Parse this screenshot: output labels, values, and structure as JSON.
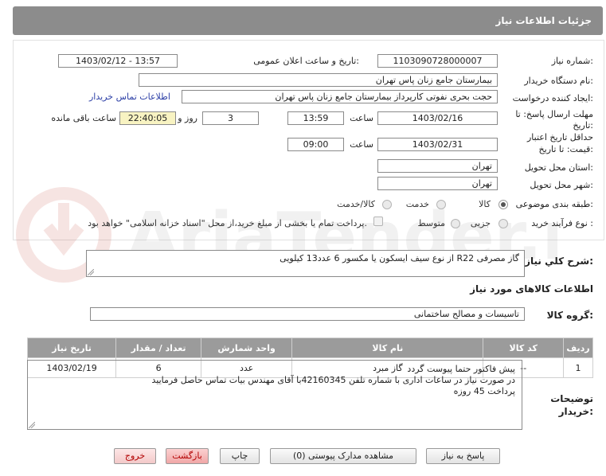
{
  "header": {
    "title": "جزئیات اطلاعات نیاز"
  },
  "form": {
    "need_number_label": "شماره نیاز:",
    "need_number": "1103090728000007",
    "announce_label": "تاریخ و ساعت اعلان عمومی:",
    "announce_value": "1403/02/12 - 13:57",
    "buyer_org_label": "نام دستگاه خریدار:",
    "buyer_org": "بیمارستان جامع زنان پاس تهران",
    "creator_label": "ایجاد کننده درخواست:",
    "creator": "حجت بحری نفوتی کارپرداز بیمارستان جامع زنان پاس تهران",
    "contact_link": "اطلاعات تماس خریدار",
    "deadline_label_1": "مهلت ارسال پاسخ: تا",
    "deadline_label_2": "تاریخ:",
    "deadline_date": "1403/02/16",
    "time_label": "ساعت",
    "deadline_time": "13:59",
    "days": "3",
    "days_label": "روز و",
    "remaining": "22:40:05",
    "remaining_label": "ساعت باقی مانده",
    "validity_label_1": "حداقل تاریخ اعتبار",
    "validity_label_2": "قیمت: تا تاریخ:",
    "validity_date": "1403/02/31",
    "validity_time_label": "ساعت",
    "validity_time": "09:00",
    "province_label": "استان محل تحویل:",
    "province": "تهران",
    "city_label": "شهر محل تحویل:",
    "city": "تهران",
    "category_label": "طبقه بندی موضوعی:",
    "category_options": [
      "کالا",
      "خدمت",
      "کالا/خدمت"
    ],
    "process_label": "نوع فرآیند خرید :",
    "process_options": [
      "جزیی",
      "متوسط"
    ],
    "payment_note": "پرداخت تمام یا بخشی از مبلغ خرید،از محل \"اسناد خزانه اسلامی\" خواهد بود."
  },
  "summary": {
    "label": "شرح کلي نياز:",
    "text": "گاز مصرفی R22 از نوع سیف ایسکون یا مکسور 6 عدد13 کیلویی"
  },
  "goods": {
    "section_title": "اطلاعات کالاهای مورد نیاز",
    "group_label": "گروه کالا:",
    "group_value": "تاسیسات و مصالح ساختمانی",
    "columns": [
      "ردیف",
      "کد کالا",
      "نام کالا",
      "واحد شمارش",
      "تعداد / مقدار",
      "تاریخ نیاز"
    ],
    "rows": [
      [
        "1",
        "--",
        "گاز مبرد",
        "عدد",
        "6",
        "1403/02/19"
      ]
    ]
  },
  "buyer_notes": {
    "label_1": "توضیحات",
    "label_2": "خریدار:",
    "line_1": "پیش فاکتور حتما پیوست گردد",
    "line_2": "در صورت نیاز در ساعات اداری با شماره تلفن 42160345با آقای مهندس بیات تماس حاصل فرمایید",
    "line_3": "پرداخت 45 روزه"
  },
  "buttons": {
    "reply": "پاسخ به نیاز",
    "attachments": "مشاهده مدارک پیوستی (0)",
    "print": "چاپ",
    "back": "بازگشت",
    "exit": "خروج"
  },
  "watermark": {
    "text": "AriaTender.net"
  },
  "colors": {
    "header_bg": "#8c8c8c",
    "table_header_bg": "#9b9b9b",
    "link": "#2c3fa6",
    "yellow_field": "#f8f3c2",
    "exit_text": "#b20000"
  }
}
